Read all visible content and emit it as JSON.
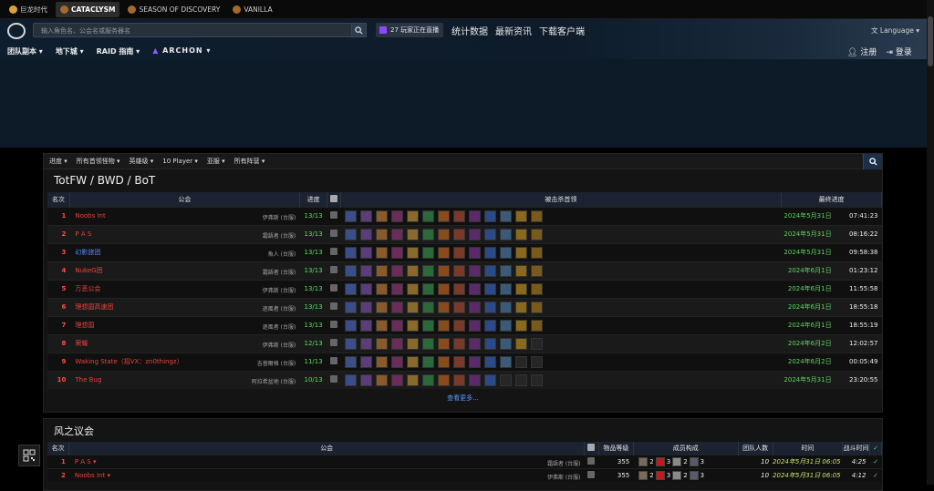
{
  "game_tabs": [
    {
      "label": "巨龙时代"
    },
    {
      "label": "CATACLYSM"
    },
    {
      "label": "SEASON OF DISCOVERY"
    },
    {
      "label": "VANILLA"
    }
  ],
  "search": {
    "placeholder": "输入角色名、公会名或服务器名"
  },
  "live": {
    "label": "27 玩家正在直播"
  },
  "top_nav": [
    "统计数据",
    "最新资讯",
    "下载客户端"
  ],
  "language": "Language",
  "nav": [
    "团队副本",
    "地下城",
    "RAID 指南",
    "ARCHON"
  ],
  "auth": {
    "register": "注册",
    "login": "登录"
  },
  "filters": [
    "进度",
    "所有首领怪物",
    "英雄级",
    "10 Player",
    "亚服",
    "所有阵营"
  ],
  "panel_title": "TotFW / BWD / BoT",
  "table1": {
    "headers": [
      "名次",
      "公会",
      "进度",
      "被击杀首领",
      "最终进度"
    ],
    "rows": [
      {
        "rank": "1",
        "name": "Noobs Int",
        "server": "伊弗斯 (台服)",
        "progress": "13/13",
        "date": "2024年5月31日",
        "time": "07:41:23",
        "blue": false
      },
      {
        "rank": "2",
        "name": "P A S",
        "server": "霜語者 (台服)",
        "progress": "13/13",
        "date": "2024年5月31日",
        "time": "08:16:22",
        "blue": false
      },
      {
        "rank": "3",
        "name": "幻影旅团",
        "server": "魚人 (台服)",
        "progress": "13/13",
        "date": "2024年5月31日",
        "time": "09:58:38",
        "blue": true
      },
      {
        "rank": "4",
        "name": "NukeG团",
        "server": "霜語者 (台服)",
        "progress": "13/13",
        "date": "2024年6月1日",
        "time": "01:23:12",
        "blue": false
      },
      {
        "rank": "5",
        "name": "万恶公会",
        "server": "伊弗斯 (台服)",
        "progress": "13/13",
        "date": "2024年6月1日",
        "time": "11:55:58",
        "blue": false
      },
      {
        "rank": "6",
        "name": "理想国高速团",
        "server": "逐風者 (台服)",
        "progress": "13/13",
        "date": "2024年6月1日",
        "time": "18:55:18",
        "blue": false
      },
      {
        "rank": "7",
        "name": "理想国",
        "server": "逐風者 (台服)",
        "progress": "13/13",
        "date": "2024年6月1日",
        "time": "18:55:19",
        "blue": false
      },
      {
        "rank": "8",
        "name": "荣耀",
        "server": "伊弗斯 (台服)",
        "progress": "12/13",
        "date": "2024年6月2日",
        "time": "12:02:57",
        "blue": false
      },
      {
        "rank": "9",
        "name": "Waking State（招VX：zn0thingz）",
        "server": "吉普爾格 (台服)",
        "progress": "11/13",
        "date": "2024年6月2日",
        "time": "00:05:49",
        "blue": false
      },
      {
        "rank": "10",
        "name": "The Bug",
        "server": "阿拉希盆地 (台服)",
        "progress": "10/13",
        "date": "2024年5月31日",
        "time": "23:20:55",
        "blue": false
      }
    ]
  },
  "more_label": "查看更多...",
  "panel2_title": "风之议会",
  "table2": {
    "headers": [
      "名次",
      "公会",
      "物品等级",
      "成员构成",
      "团队人数",
      "时间",
      "战斗时间"
    ],
    "rows": [
      {
        "rank": "1",
        "name": "P A S",
        "server": "霜語者 (台服)",
        "ilvl": "355",
        "c1": "2",
        "c2": "3",
        "c3": "2",
        "c4": "3",
        "size": "10",
        "date": "2024年5月31日 06:05",
        "dur": "4:25"
      },
      {
        "rank": "2",
        "name": "Noobs Int",
        "server": "伊弗斯 (台服)",
        "ilvl": "355",
        "c1": "2",
        "c2": "3",
        "c3": "2",
        "c4": "3",
        "size": "10",
        "date": "2024年5月31日 06:05",
        "dur": "4:12"
      }
    ]
  }
}
